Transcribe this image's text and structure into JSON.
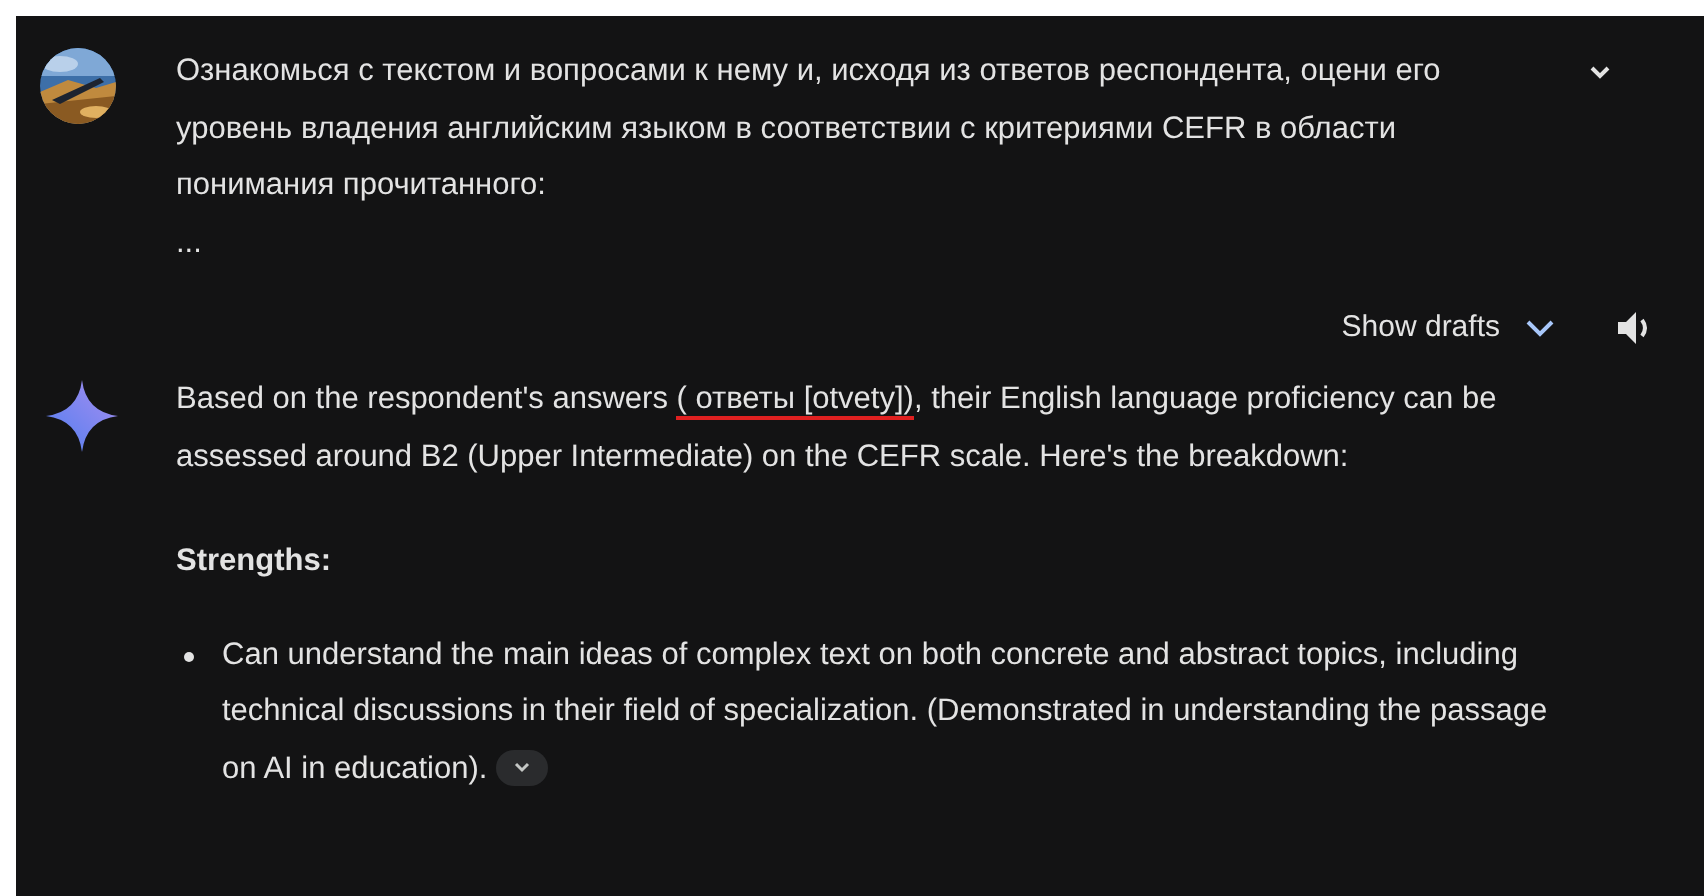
{
  "prompt": {
    "text": "Ознакомься с текстом и вопросами к нему и, исходя из ответов респондента, оцени его уровень владения английским языком в соответствии с критериями CEFR в области понимания прочитанного:",
    "ellipsis": "...",
    "expanded": false
  },
  "toolbar": {
    "show_drafts": "Show drafts"
  },
  "response": {
    "intro_before": "Based on the respondent's answers ",
    "intro_underlined": "( ответы [otvety])",
    "intro_after": ", their English language proficiency can be assessed around B2 (Upper Intermediate) on the CEFR scale. Here's the breakdown:",
    "heading": "Strengths:",
    "bullets": [
      {
        "text": "Can understand the main ideas of complex text on both concrete and abstract topics, including technical discussions in their field of specialization. (Demonstrated in understanding the passage on AI in education).",
        "expanded": false
      }
    ]
  }
}
